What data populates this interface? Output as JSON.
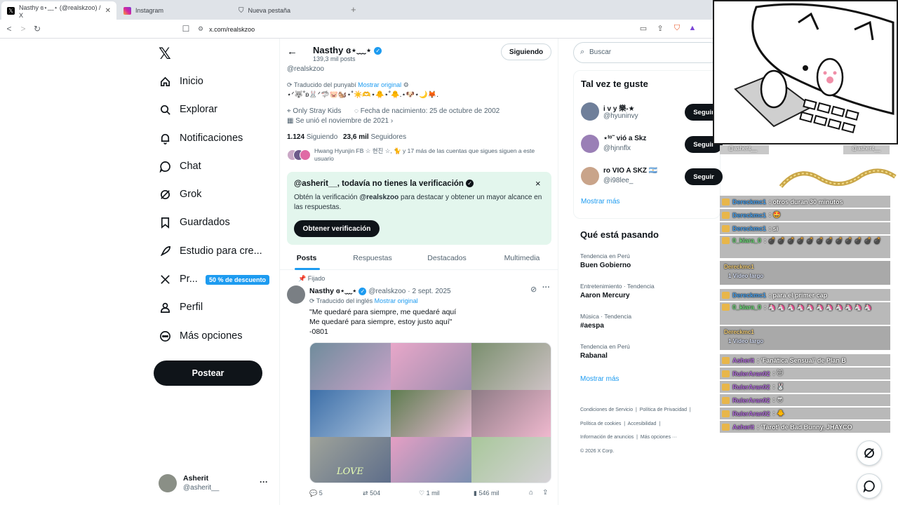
{
  "browser": {
    "tabs": [
      {
        "title": "Nasthy ɞ⋆﹏⋆ (@realskzoo) / X",
        "active": true
      },
      {
        "title": "Instagram",
        "active": false
      },
      {
        "title": "Nueva pestaña",
        "active": false
      }
    ],
    "url": "x.com/realskzoo"
  },
  "nav": {
    "items": [
      {
        "label": "Inicio",
        "icon": "home-icon"
      },
      {
        "label": "Explorar",
        "icon": "search-icon"
      },
      {
        "label": "Notificaciones",
        "icon": "bell-icon"
      },
      {
        "label": "Chat",
        "icon": "chat-icon"
      },
      {
        "label": "Grok",
        "icon": "grok-icon"
      },
      {
        "label": "Guardados",
        "icon": "bookmark-icon"
      },
      {
        "label": "Estudio para cre...",
        "icon": "rocket-icon"
      },
      {
        "label": "Pr...",
        "icon": "x-logo-icon"
      },
      {
        "label": "Perfil",
        "icon": "person-icon"
      },
      {
        "label": "Más opciones",
        "icon": "more-circle-icon"
      }
    ],
    "premium_badge": "50 % de descuento",
    "post_button": "Postear",
    "account": {
      "name": "Asherit",
      "handle": "@asherit__",
      "more": "···"
    }
  },
  "profile": {
    "name": "Nasthy ɞ⋆﹏⋆",
    "posts_count": "139,3 mil posts",
    "following_button": "Siguiendo",
    "handle": "@realskzoo",
    "translated_note": "Traducido del punyabí",
    "show_original": "Mostrar original",
    "bio": "⋆ᐟ🐺˚ʚ🐰ᐟ🦈🐷🐿️⋆˚☀️🫶⋆🐥⋆˚🐥.⋆🐶⋆🌙🦊.",
    "location": "Only Stray Kids",
    "birth": "Fecha de nacimiento: 25 de octubre de 2002",
    "joined": "Se unió el noviembre de 2021",
    "following_count": "1.124",
    "following_label": "Siguiendo",
    "followers_count": "23,6 mil",
    "followers_label": "Seguidores",
    "followed_by": "Hwang Hyunjin FB ☆ 현진 ☆, 🐈 y 17 más de las cuentas que sigues siguen a este usuario"
  },
  "verify_card": {
    "title": "@asherit__, todavía no tienes la verificación",
    "text_a": "Obtén la verificación ",
    "text_handle": "@realskzoo",
    "text_b": " para destacar y obtener un mayor alcance en las respuestas.",
    "button": "Obtener verificación",
    "close": "×"
  },
  "profile_tabs": [
    "Posts",
    "Respuestas",
    "Destacados",
    "Multimedia"
  ],
  "pinned_post": {
    "pinned_label": "Fijado",
    "author": "Nasthy ɞ⋆﹏⋆",
    "handle": "@realskzoo",
    "date": "2 sept. 2025",
    "translated_note": "Traducido del inglés",
    "show_original": "Mostrar original",
    "lines": [
      "\"Me quedaré para siempre, me quedaré aquí",
      "Me quedaré para siempre, estoy justo aquí\"",
      "-0801"
    ],
    "image_text": "LOVE",
    "stats": {
      "replies": "5",
      "reposts": "504",
      "likes": "1 mil",
      "views": "546 mil"
    }
  },
  "right": {
    "search_placeholder": "Buscar",
    "suggest_title": "Tal vez te guste",
    "suggestions": [
      {
        "name": "i v y 樂-★",
        "handle": "@hyuninvy",
        "button": "Seguir",
        "color": "#6f7f9a"
      },
      {
        "name": "⋆ᵗᵒ˜ vió a Skz",
        "handle": "@hjnnflx",
        "button": "Seguir",
        "color": "#9a7fb6"
      },
      {
        "name": "ro VIO A SKZ 🇦🇷",
        "handle": "@i98lee_",
        "button": "Seguir",
        "color": "#c9a48a"
      }
    ],
    "show_more": "Mostrar más",
    "trends_title": "Qué está pasando",
    "trends": [
      {
        "context": "Tendencia en Perú",
        "name": "Buen Gobierno"
      },
      {
        "context": "Entretenimiento · Tendencia",
        "name": "Aaron Mercury"
      },
      {
        "context": "Música · Tendencia",
        "name": "#aespa"
      },
      {
        "context": "Tendencia en Perú",
        "name": "Rabanal"
      }
    ],
    "show_more_2": "Mostrar más",
    "footer": [
      "Condiciones de Servicio",
      "Política de Privacidad",
      "Política de cookies",
      "Accesibilidad",
      "Información de anuncios",
      "Más opciones ···",
      "© 2026 X Corp."
    ]
  },
  "overlay": {
    "follower_left": "@asherit__",
    "follower_right": "@asherit__",
    "chat": [
      {
        "user": "Dereckmc1",
        "msg": ": otros duran 30 minutos"
      },
      {
        "user": "Dereckmc1",
        "msg": ": 🤩"
      },
      {
        "user": "Dereckmc1",
        "msg": ": si"
      },
      {
        "user": "0_kiara_0",
        "msg": ": 💣 💣 💣 💣 💣 💣 💣 💣 💣 💣 💣 💣"
      },
      {
        "user": "Dereckmc1",
        "msg": "1 Video largo"
      },
      {
        "user": "Dereckmc1",
        "msg": ": para el primer cap"
      },
      {
        "user": "0_kiara_0",
        "msg": ": 🦄 🦄 🦄 🦄 🦄 🦄 🦄 🦄 🦄 🦄 🦄"
      },
      {
        "user": "Dereckmc1",
        "msg": "1 Video largo"
      },
      {
        "user": "Asherit",
        "msg": ": 'Fanática Sensual' de Plan B"
      },
      {
        "user": "RulerAran02",
        "msg": ": 😽"
      },
      {
        "user": "RulerAran02",
        "msg": ": 🐰"
      },
      {
        "user": "RulerAran02",
        "msg": ": 😎"
      },
      {
        "user": "RulerAran02",
        "msg": ": 🐥"
      },
      {
        "user": "Asherit",
        "msg": ": 'Tarot' de Bad Bunny, JHAYCO"
      }
    ]
  },
  "colors": {
    "accent": "#1d9bf0",
    "verify_bg": "#e3f6ed",
    "chat_bg": "#b9b9b9"
  }
}
